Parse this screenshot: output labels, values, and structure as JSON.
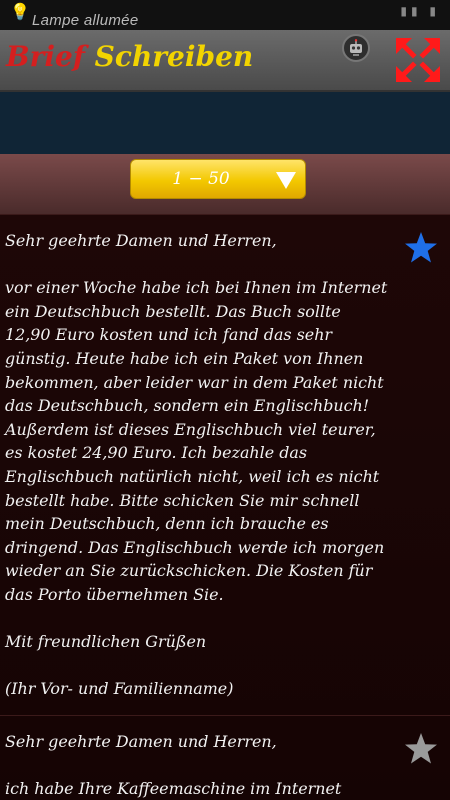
{
  "status_bar": {
    "notification": "Lampe allumée",
    "icons": [
      "bulb-icon",
      "signal-icon",
      "battery-icon"
    ]
  },
  "app_bar": {
    "title_word_1": "Brief",
    "title_word_2": "Schreiben",
    "title_colors": {
      "word_1": "#d41f1f",
      "word_2": "#f2d400"
    },
    "robot_button_icon": "robot-icon",
    "expand_button_icon": "expand-arrows-icon",
    "expand_color": "#ff1a1a"
  },
  "filter": {
    "range_label": "1 − 50",
    "dropdown_icon": "triangle-down-icon"
  },
  "letters": [
    {
      "text": "Sehr geehrte Damen und Herren,\n\nvor einer Woche habe ich bei Ihnen im Internet ein Deutschbuch bestellt. Das Buch sollte 12,90 Euro kosten und ich fand das sehr günstig. Heute habe ich ein Paket von Ihnen bekommen, aber leider war in dem Paket nicht das Deutschbuch, sondern ein Englischbuch! Außerdem ist dieses Englischbuch viel teurer, es kostet 24,90 Euro. Ich bezahle das Englischbuch natürlich nicht, weil ich es nicht bestellt habe. Bitte schicken Sie mir schnell mein Deutschbuch, denn ich brauche es dringend. Das Englischbuch werde ich morgen wieder an Sie zurückschicken. Die Kosten für das Porto übernehmen Sie.\n\nMit freundlichen Grüßen\n\n(Ihr Vor- und Familienname)",
      "favorite": true,
      "star_color": "#1f6fe8"
    },
    {
      "text": "Sehr geehrte Damen und Herren,\n\nich habe Ihre Kaffeemaschine im Internet",
      "favorite": false,
      "star_color": "#9a9a9a"
    }
  ]
}
